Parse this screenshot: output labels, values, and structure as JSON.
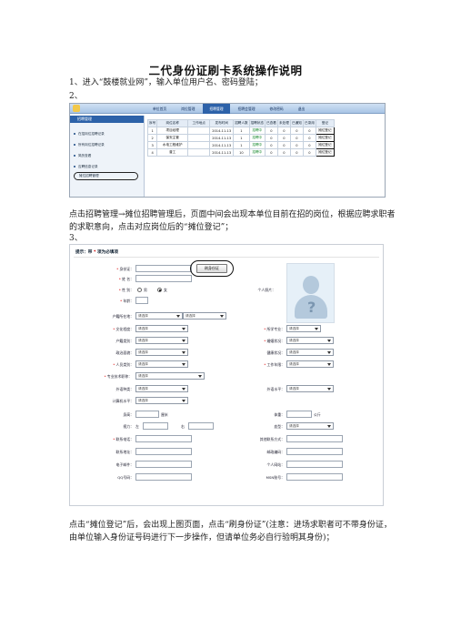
{
  "title": "二代身份证刷卡系统操作说明",
  "step1": "1、进入“鼓楼就业网”，输入单位用户名、密码登陆；",
  "step2_label": "2、",
  "para2": "点击招聘管理→摊位招聘管理后，页面中间会出现本单位目前在招的岗位，根据应聘求职者的求职意向，点击对应岗位后的“摊位登记”；",
  "step3_label": "3、",
  "para3": "点击“摊位登记”后，会出现上图页面，点击“刷身份证”(注意：进场求职者可不带身份证，由单位输入身份证号码进行下一步操作，但请单位务必自行验明其身份)；",
  "screenshot1": {
    "nav": [
      "单位首页",
      "岗位管理",
      "招聘管理",
      "招聘会管理",
      "修改密码",
      "退出"
    ],
    "active_nav": "招聘管理",
    "sidebar_title": "招聘管理",
    "sidebar_items": [
      "在招岗位招聘记录",
      "所有岗位招聘记录",
      "简历查看",
      "应聘信息记录",
      "摊位招聘管理"
    ],
    "table_headers": [
      "序号",
      "岗位名称",
      "工作地点",
      "发布时间",
      "招聘人数",
      "招聘状态",
      "已查看",
      "未处理",
      "已通知",
      "已录用",
      "登记"
    ],
    "rows": [
      [
        "1",
        "项目经理",
        "",
        "2014-11-13",
        "1",
        "招聘中",
        "0",
        "0",
        "0",
        "0",
        "摊位登记"
      ],
      [
        "2",
        "保安主管",
        "",
        "2014-11-13",
        "1",
        "招聘中",
        "0",
        "0",
        "0",
        "0",
        "摊位登记"
      ],
      [
        "3",
        "水电工程维护",
        "",
        "2014-11-13",
        "1",
        "招聘中",
        "0",
        "0",
        "0",
        "0",
        "摊位登记"
      ],
      [
        "4",
        "普工",
        "",
        "2014-11-13",
        "10",
        "招聘中",
        "0",
        "0",
        "0",
        "0",
        "摊位登记"
      ]
    ]
  },
  "screenshot2": {
    "heading_prefix": "提示：带",
    "heading_star": "*",
    "heading_suffix": "项为必填项",
    "scan_button": "刷身份证",
    "id_label": "身份证：",
    "name_label": "姓  名：",
    "gender_label": "性  别：",
    "male": "男",
    "female": "女",
    "age_label": "年龄：",
    "photo_label": "个人照片：",
    "hukou_label": "户籍所在地：",
    "education_label": "文化程度：",
    "major_label": "所学专业：",
    "hukou_type_label": "户籍类别：",
    "marital_label": "婚姻状况：",
    "political_label": "政治面貌：",
    "health_label": "健康状况：",
    "category_label": "人员类别：",
    "work_years_label": "工作年限：",
    "tech_label": "专业技术职称：",
    "foreign_lang_label": "外语种类：",
    "foreign_level_label": "外语水平：",
    "computer_label": "计算机水平：",
    "height_label": "身高：",
    "height_unit": "厘米",
    "weight_label": "体重：",
    "weight_unit": "公斤",
    "vision_label": "视力：",
    "left_eye": "左",
    "right_eye": "右",
    "blood_label": "血型：",
    "phone_label": "联系电话：",
    "other_contact_label": "其他联系方式：",
    "address_label": "联系地址：",
    "postcode_label": "邮政编码：",
    "email_label": "电子邮件：",
    "homepage_label": "个人网站：",
    "qq_label": "QQ号码：",
    "msn_label": "MSN账号：",
    "select_placeholder": "请选择"
  }
}
